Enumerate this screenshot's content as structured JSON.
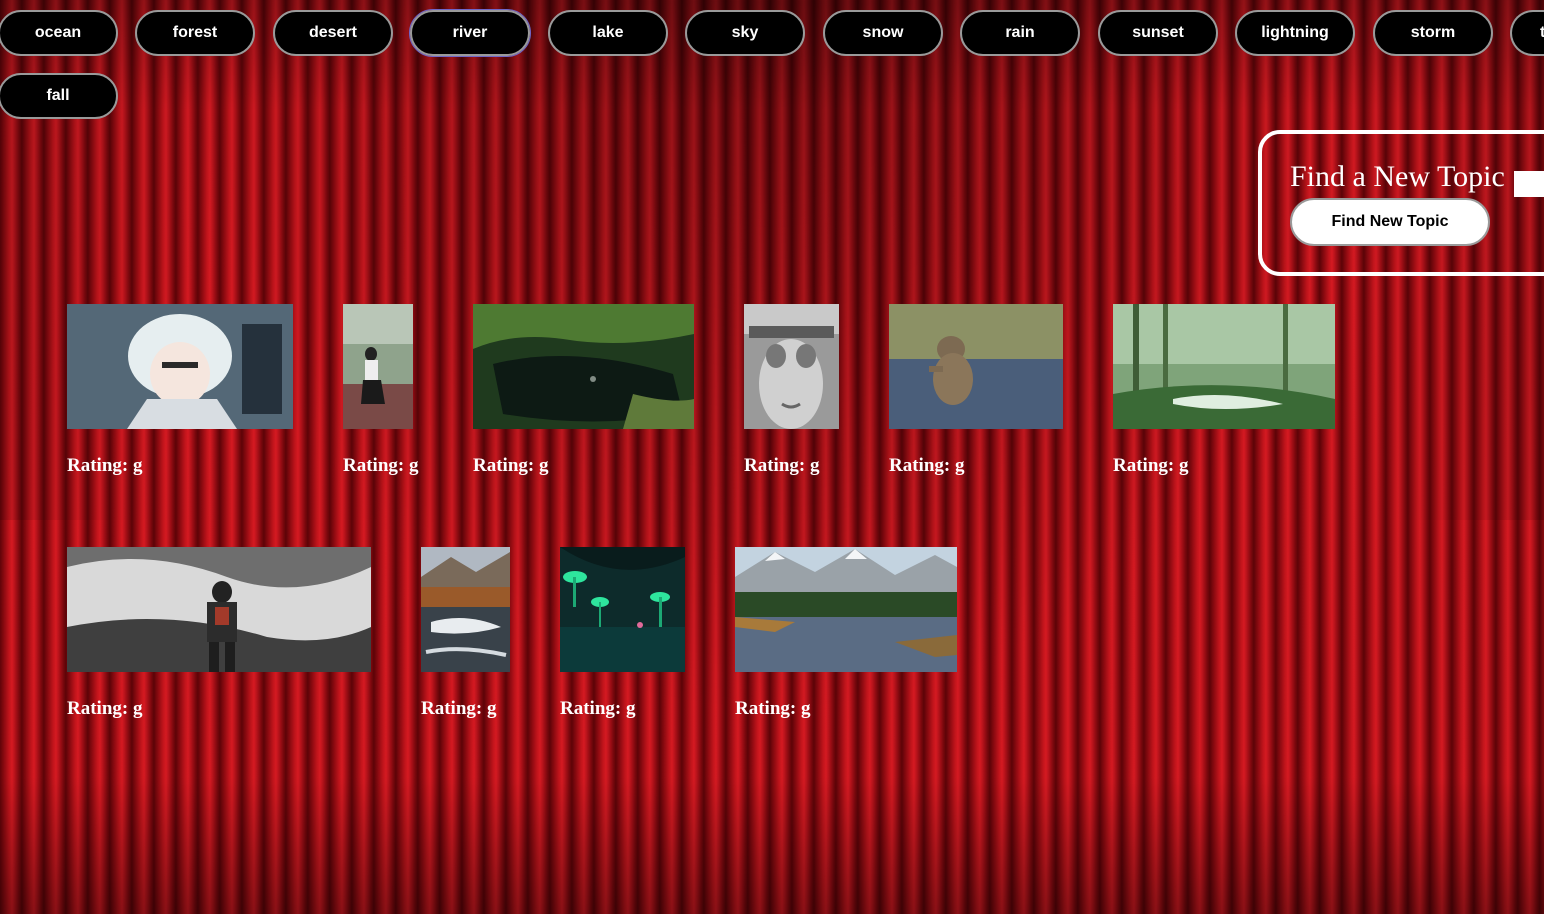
{
  "topics": [
    "ocean",
    "forest",
    "desert",
    "river",
    "lake",
    "sky",
    "snow",
    "rain",
    "sunset",
    "lightning",
    "storm",
    "t",
    "fall"
  ],
  "active_topic": "river",
  "search": {
    "label": "Find a New Topic",
    "input_value": "",
    "button_label": "Find New Topic"
  },
  "gifs": [
    {
      "rating_label": "Rating: g",
      "subject": "anime character with white hair"
    },
    {
      "rating_label": "Rating: g",
      "subject": "person walking on riverside path"
    },
    {
      "rating_label": "Rating: g",
      "subject": "dark green pond with plants"
    },
    {
      "rating_label": "Rating: g",
      "subject": "surreal face with bridge"
    },
    {
      "rating_label": "Rating: g",
      "subject": "monkey standing in water"
    },
    {
      "rating_label": "Rating: g",
      "subject": "misty forest stream"
    },
    {
      "rating_label": "Rating: g",
      "subject": "person standing before rushing rapids"
    },
    {
      "rating_label": "Rating: g",
      "subject": "rocky mountain stream"
    },
    {
      "rating_label": "Rating: g",
      "subject": "glowing mushrooms by dark water"
    },
    {
      "rating_label": "Rating: g",
      "subject": "mountain river with pine forest"
    }
  ],
  "colors": {
    "curtain": "#c0141b",
    "button_bg": "#000000",
    "button_text": "#ffffff",
    "button_border": "#9a9a9a",
    "active_outline": "#6f67c9"
  }
}
